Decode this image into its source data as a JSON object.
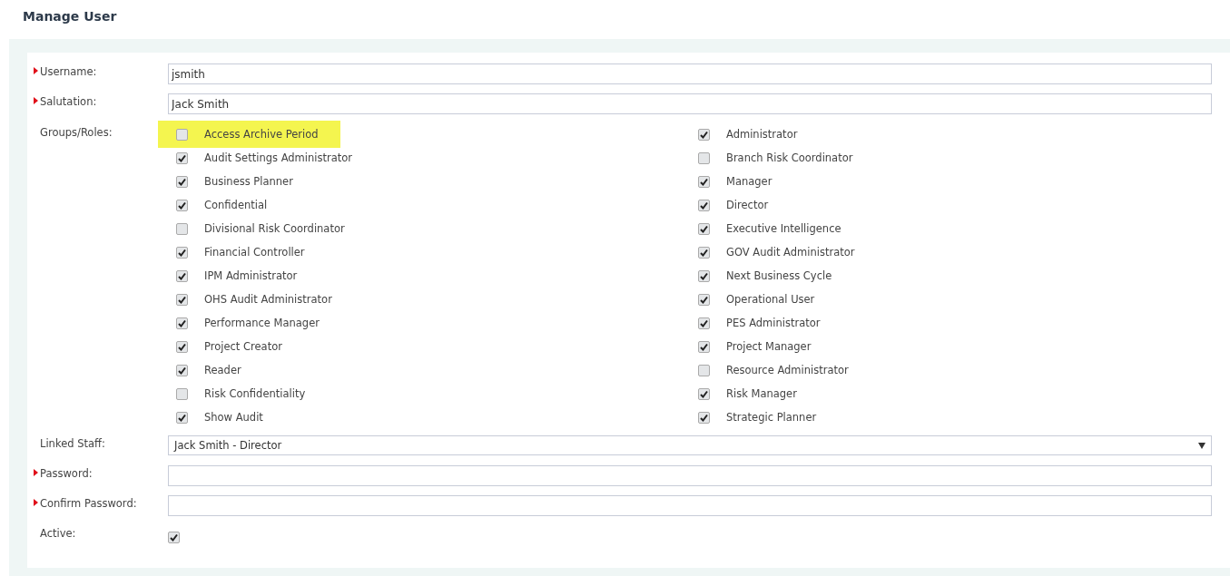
{
  "page": {
    "title": "Manage User"
  },
  "fields_top": [
    {
      "kind": "text",
      "label": "Username:",
      "required": true,
      "value": "jsmith"
    },
    {
      "kind": "text",
      "label": "Salutation:",
      "required": true,
      "value": "Jack Smith"
    }
  ],
  "groups": {
    "label": "Groups/Roles:",
    "required": false,
    "roles": [
      {
        "label": "Access Archive Period",
        "checked": false,
        "highlighted": true
      },
      {
        "label": "Administrator",
        "checked": true,
        "highlighted": false
      },
      {
        "label": "Audit Settings Administrator",
        "checked": true,
        "highlighted": false
      },
      {
        "label": "Branch Risk Coordinator",
        "checked": false,
        "highlighted": false
      },
      {
        "label": "Business Planner",
        "checked": true,
        "highlighted": false
      },
      {
        "label": "Manager",
        "checked": true,
        "highlighted": false
      },
      {
        "label": "Confidential",
        "checked": true,
        "highlighted": false
      },
      {
        "label": "Director",
        "checked": true,
        "highlighted": false
      },
      {
        "label": "Divisional Risk Coordinator",
        "checked": false,
        "highlighted": false
      },
      {
        "label": "Executive Intelligence",
        "checked": true,
        "highlighted": false
      },
      {
        "label": "Financial Controller",
        "checked": true,
        "highlighted": false
      },
      {
        "label": "GOV Audit Administrator",
        "checked": true,
        "highlighted": false
      },
      {
        "label": "IPM Administrator",
        "checked": true,
        "highlighted": false
      },
      {
        "label": "Next Business Cycle",
        "checked": true,
        "highlighted": false
      },
      {
        "label": "OHS Audit Administrator",
        "checked": true,
        "highlighted": false
      },
      {
        "label": "Operational User",
        "checked": true,
        "highlighted": false
      },
      {
        "label": "Performance Manager",
        "checked": true,
        "highlighted": false
      },
      {
        "label": "PES Administrator",
        "checked": true,
        "highlighted": false
      },
      {
        "label": "Project Creator",
        "checked": true,
        "highlighted": false
      },
      {
        "label": "Project Manager",
        "checked": true,
        "highlighted": false
      },
      {
        "label": "Reader",
        "checked": true,
        "highlighted": false
      },
      {
        "label": "Resource Administrator",
        "checked": false,
        "highlighted": false
      },
      {
        "label": "Risk Confidentiality",
        "checked": false,
        "highlighted": false
      },
      {
        "label": "Risk Manager",
        "checked": true,
        "highlighted": false
      },
      {
        "label": "Show Audit",
        "checked": true,
        "highlighted": false
      },
      {
        "label": "Strategic Planner",
        "checked": true,
        "highlighted": false
      }
    ]
  },
  "fields_bottom": [
    {
      "kind": "select",
      "label": "Linked Staff:",
      "required": false,
      "value": "Jack Smith - Director"
    },
    {
      "kind": "password",
      "label": "Password:",
      "required": true
    },
    {
      "kind": "password",
      "label": "Confirm Password:",
      "required": true
    },
    {
      "kind": "checkbox",
      "label": "Active:",
      "required": false,
      "checked": true
    }
  ]
}
